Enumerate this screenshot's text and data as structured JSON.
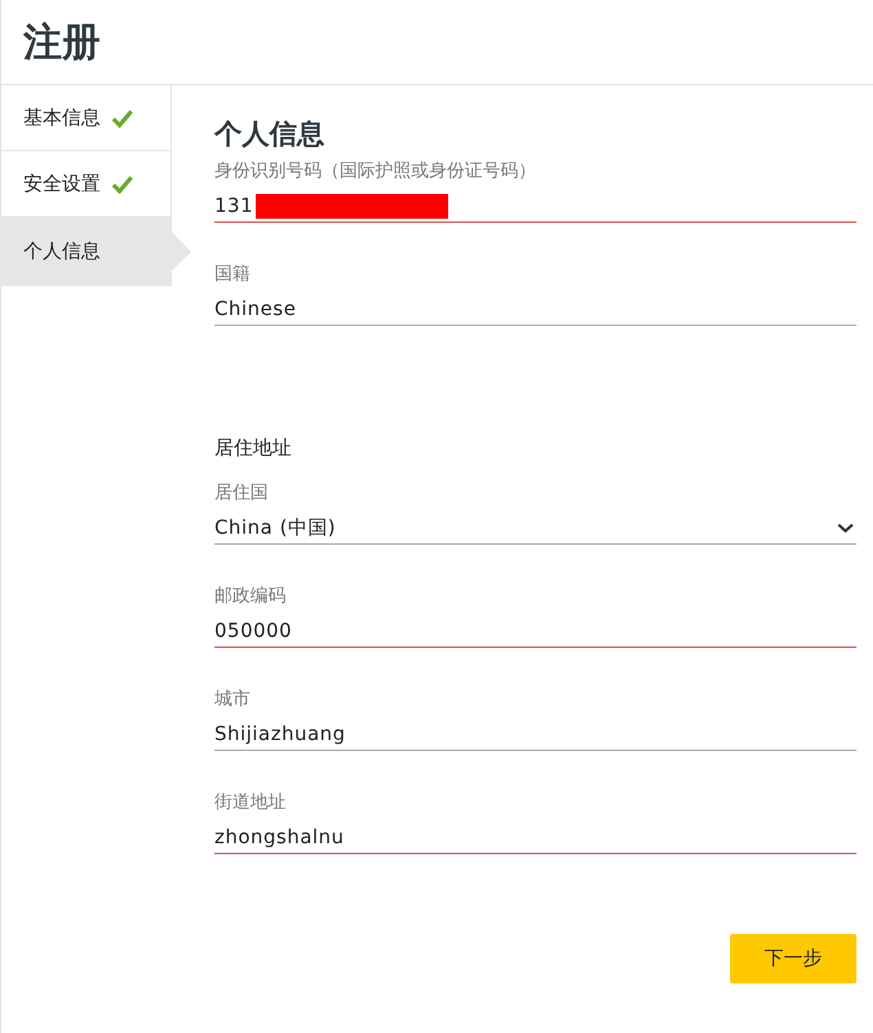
{
  "page_title": "注册",
  "steps": [
    {
      "label": "基本信息",
      "completed": true,
      "selected": false
    },
    {
      "label": "安全设置",
      "completed": true,
      "selected": false
    },
    {
      "label": "个人信息",
      "completed": false,
      "selected": true
    }
  ],
  "section_title": "个人信息",
  "fields": [
    {
      "kind": "text",
      "label": "身份识别号码（国际护照或身份证号码）",
      "value": "131",
      "error": true,
      "redacted": true
    },
    {
      "kind": "text",
      "label": "国籍",
      "value": "Chinese",
      "error": false
    },
    {
      "kind": "heading",
      "label": "居住地址"
    },
    {
      "kind": "select",
      "label": "居住国",
      "value": "China (中国)",
      "error": false
    },
    {
      "kind": "text",
      "label": "邮政编码",
      "value": "050000",
      "error": true
    },
    {
      "kind": "text",
      "label": "城市",
      "value": "Shijiazhuang",
      "error": false
    },
    {
      "kind": "text",
      "label": "街道地址",
      "value": "zhongshalnu",
      "error": true
    }
  ],
  "next_button": "下一步"
}
